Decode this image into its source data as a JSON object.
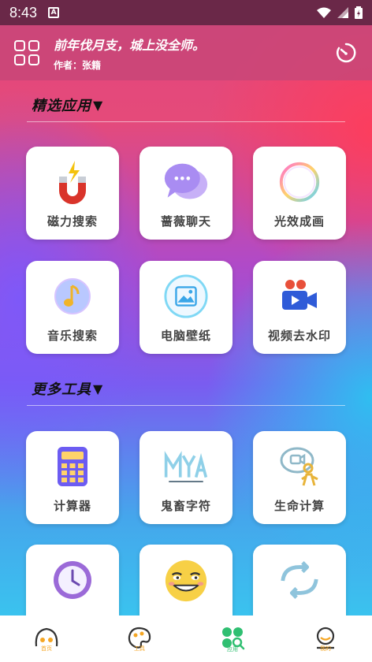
{
  "status_bar": {
    "time": "8:43",
    "notification_icon": "A"
  },
  "header": {
    "quote": "前年伐月支，城上没全师。",
    "author": "作者：张籍"
  },
  "sections": [
    {
      "title": "精选应用",
      "arrow": "▼"
    },
    {
      "title": "更多工具",
      "arrow": "▼"
    }
  ],
  "featured_apps": [
    {
      "label": "磁力搜索",
      "icon": "magnet-icon"
    },
    {
      "label": "蔷薇聊天",
      "icon": "chat-bubble-icon"
    },
    {
      "label": "光效成画",
      "icon": "glow-ring-icon"
    },
    {
      "label": "音乐搜索",
      "icon": "music-note-icon"
    },
    {
      "label": "电脑壁纸",
      "icon": "image-frame-icon"
    },
    {
      "label": "视频去水印",
      "icon": "video-camera-icon"
    }
  ],
  "more_tools": [
    {
      "label": "计算器",
      "icon": "calculator-icon"
    },
    {
      "label": "鬼畜字符",
      "icon": "ascii-art-icon"
    },
    {
      "label": "生命计算",
      "icon": "person-chat-icon"
    },
    {
      "label": "",
      "icon": "clock-icon"
    },
    {
      "label": "",
      "icon": "smiley-face-icon"
    },
    {
      "label": "",
      "icon": "refresh-arrows-icon"
    }
  ],
  "tabs": [
    {
      "label": "首页",
      "icon": "home-icon"
    },
    {
      "label": "工具",
      "icon": "palette-icon"
    },
    {
      "label": "应用",
      "icon": "apps-search-icon"
    },
    {
      "label": "我的",
      "icon": "profile-icon"
    }
  ]
}
